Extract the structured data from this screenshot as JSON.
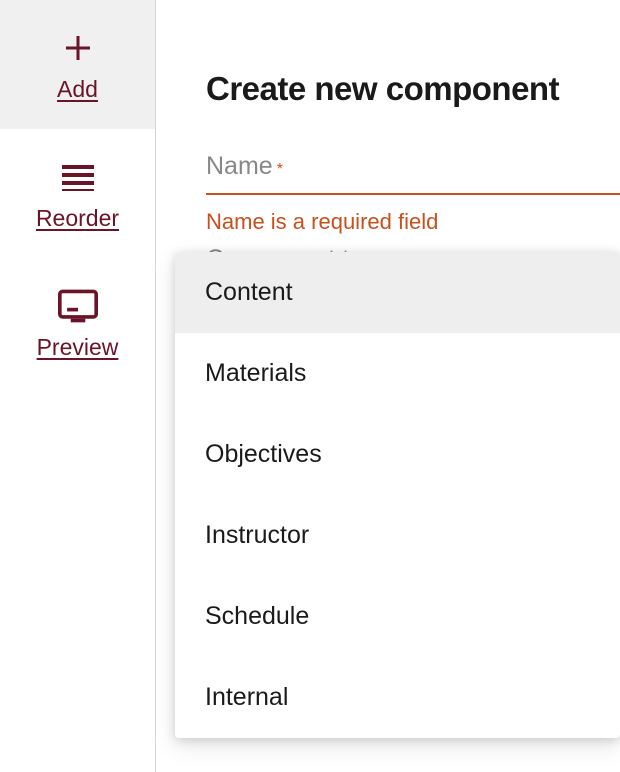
{
  "sidebar": {
    "items": [
      {
        "label": "Add",
        "icon": "plus",
        "active": true
      },
      {
        "label": "Reorder",
        "icon": "reorder",
        "active": false
      },
      {
        "label": "Preview",
        "icon": "preview",
        "active": false
      }
    ]
  },
  "main": {
    "title": "Create new component",
    "nameField": {
      "label": "Name",
      "required": "*",
      "error": "Name is a required field"
    },
    "componentTypeField": {
      "partialLabel": "Component type",
      "required": "*"
    }
  },
  "dropdown": {
    "options": [
      "Content",
      "Materials",
      "Objectives",
      "Instructor",
      "Schedule",
      "Internal"
    ],
    "selectedIndex": 0
  },
  "colors": {
    "accent": "#6b1428",
    "error": "#c8501e"
  }
}
